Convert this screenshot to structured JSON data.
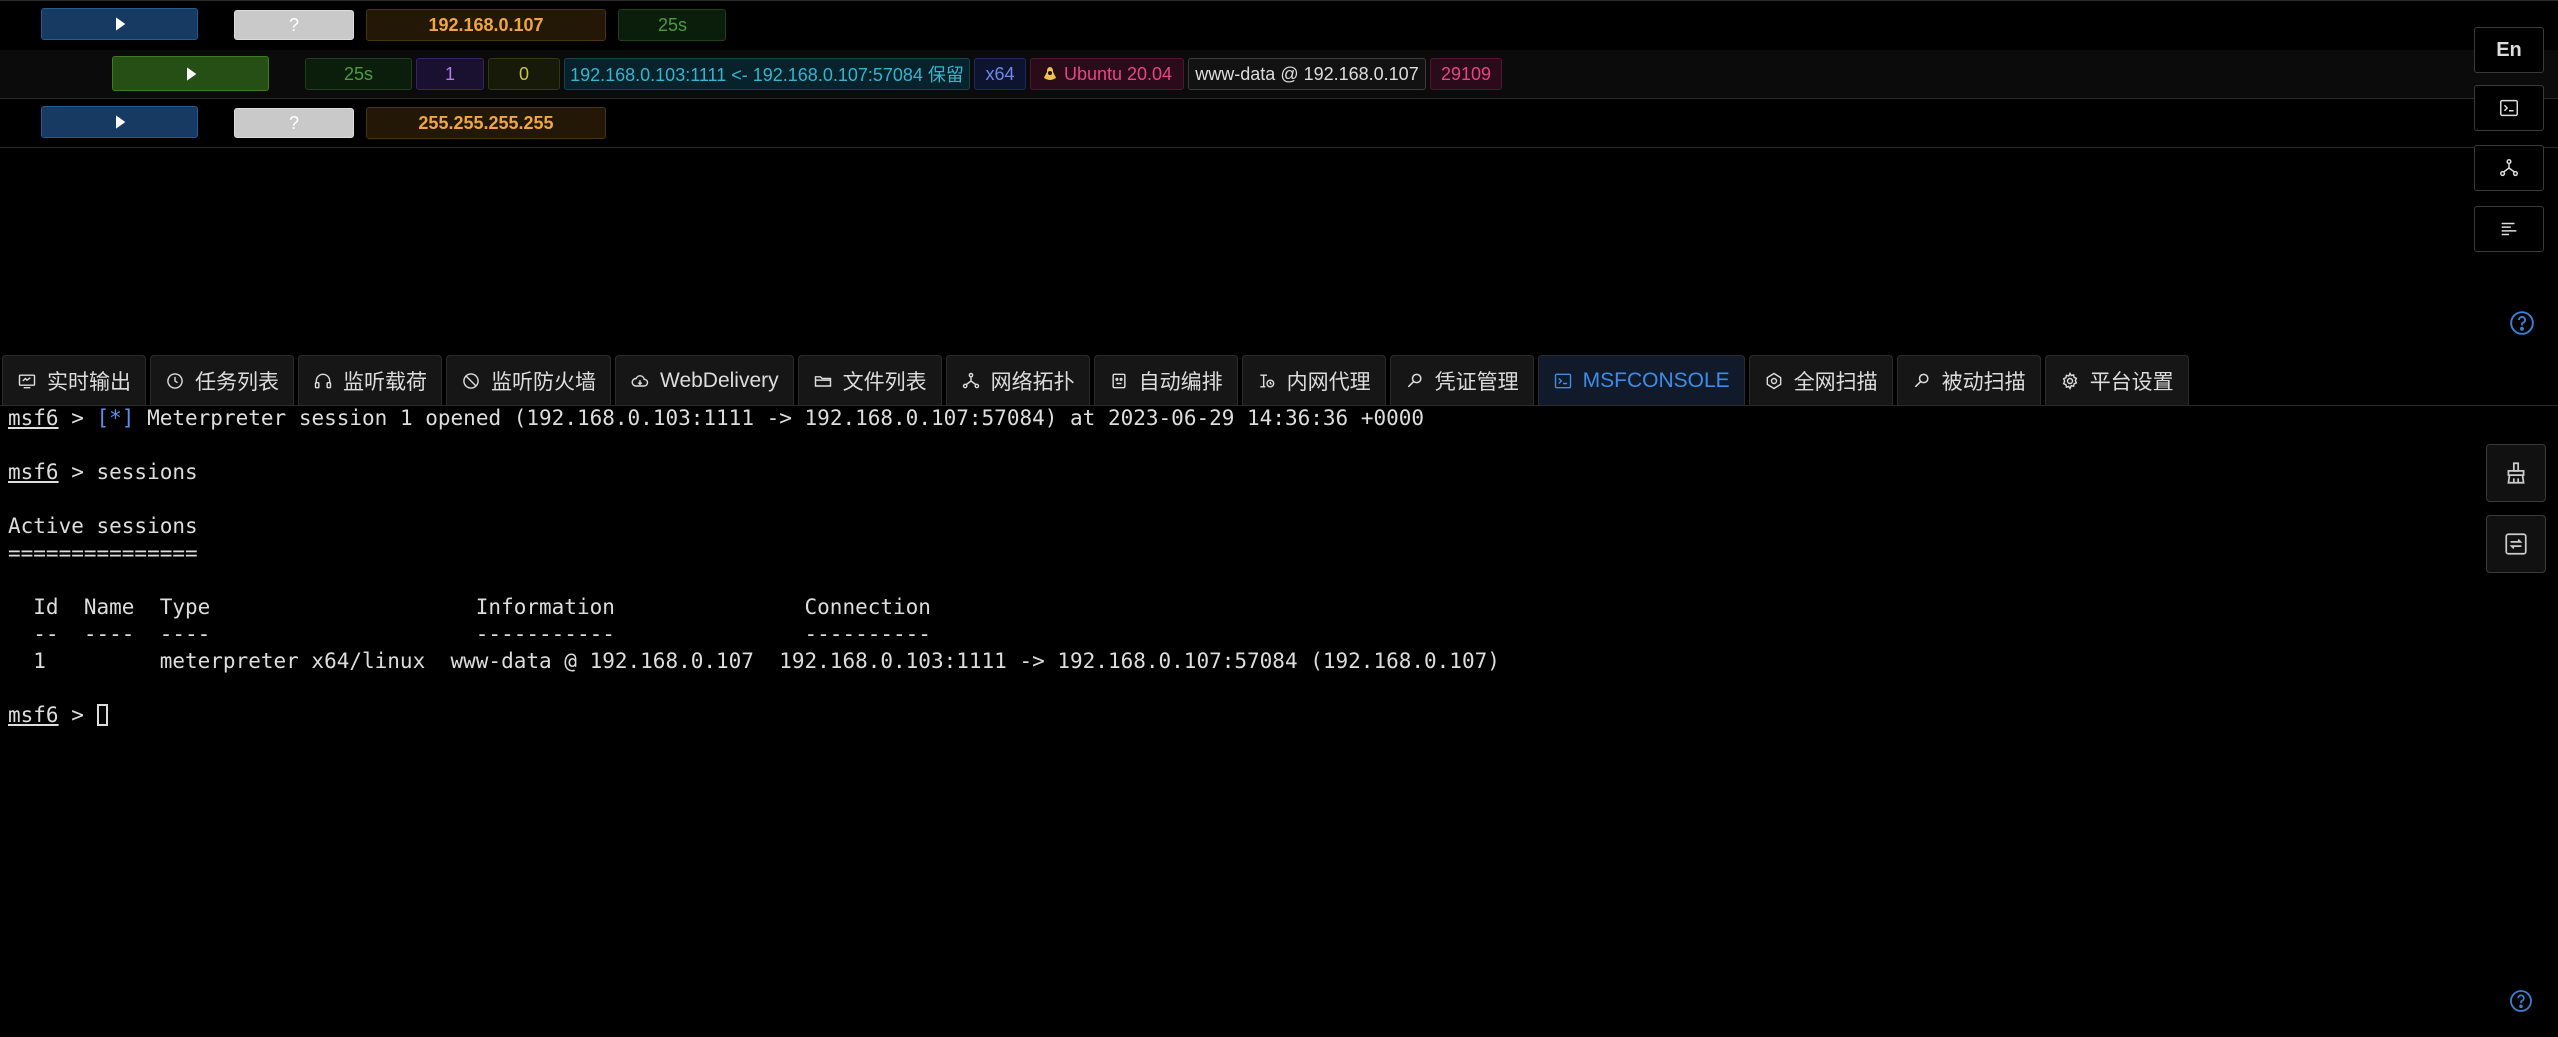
{
  "hosts": [
    {
      "status": "?",
      "ip": "192.168.0.107",
      "age": "25s"
    },
    {
      "status": "?",
      "ip": "255.255.255.255"
    }
  ],
  "session": {
    "age": "25s",
    "id": "1",
    "count": "0",
    "connection": "192.168.0.103:1111 <- 192.168.0.107:57084 保留",
    "arch": "x64",
    "os": "Ubuntu 20.04",
    "user": "www-data @ 192.168.0.107",
    "pid": "29109"
  },
  "sidebar": {
    "lang": "En"
  },
  "tabs": [
    {
      "label": "实时输出",
      "icon": "monitor-icon"
    },
    {
      "label": "任务列表",
      "icon": "history-icon"
    },
    {
      "label": "监听载荷",
      "icon": "headphones-icon"
    },
    {
      "label": "监听防火墙",
      "icon": "stop-icon"
    },
    {
      "label": "WebDelivery",
      "icon": "cloud-icon"
    },
    {
      "label": "文件列表",
      "icon": "folder-icon"
    },
    {
      "label": "网络拓扑",
      "icon": "topology-icon"
    },
    {
      "label": "自动编排",
      "icon": "robot-icon"
    },
    {
      "label": "内网代理",
      "icon": "proxy-icon"
    },
    {
      "label": "凭证管理",
      "icon": "key-icon"
    },
    {
      "label": "MSFCONSOLE",
      "icon": "terminal-icon",
      "active": true
    },
    {
      "label": "全网扫描",
      "icon": "scan-icon"
    },
    {
      "label": "被动扫描",
      "icon": "passive-scan-icon"
    },
    {
      "label": "平台设置",
      "icon": "gear-icon"
    }
  ],
  "terminal": {
    "prompt": "msf6",
    "line1_star": "[*]",
    "line1_text": " Meterpreter session 1 opened (192.168.0.103:1111 -> 192.168.0.107:57084) at 2023-06-29 14:36:36 +0000",
    "line2_cmd": " > sessions",
    "active_title": "Active sessions",
    "active_underline": "===============",
    "table_header": "  Id  Name  Type                     Information               Connection",
    "table_rule": "  --  ----  ----                     -----------               ----------",
    "table_row": "  1         meterpreter x64/linux  www-data @ 192.168.0.107  192.168.0.103:1111 -> 192.168.0.107:57084 (192.168.0.107)",
    "prompt_suffix": " > ",
    "prompt_suffix_star": " > "
  },
  "colors": {
    "accent": "#3a8ee6",
    "ip": "#f0a640",
    "os": "#e9457f"
  }
}
